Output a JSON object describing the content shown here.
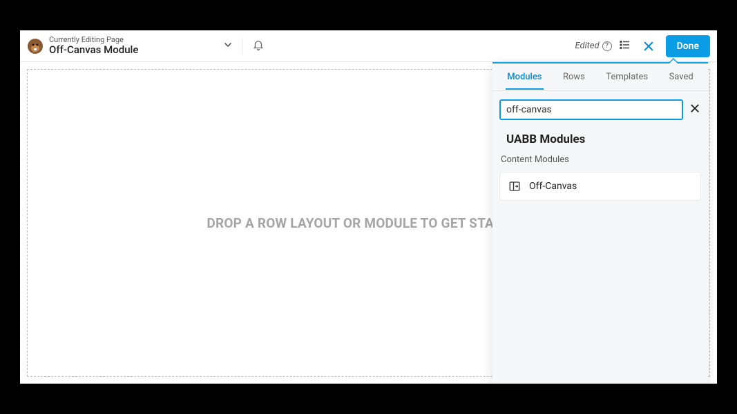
{
  "header": {
    "subtitle": "Currently Editing Page",
    "title": "Off-Canvas Module",
    "edited_label": "Edited",
    "done_label": "Done"
  },
  "canvas": {
    "placeholder": "DROP A ROW LAYOUT OR MODULE TO GET STARTED!"
  },
  "panel": {
    "tabs": [
      {
        "label": "Modules",
        "active": true
      },
      {
        "label": "Rows",
        "active": false
      },
      {
        "label": "Templates",
        "active": false
      },
      {
        "label": "Saved",
        "active": false
      }
    ],
    "search_value": "off-canvas",
    "group_heading": "UABB Modules",
    "sub_heading": "Content Modules",
    "modules": [
      {
        "label": "Off-Canvas"
      }
    ]
  },
  "colors": {
    "accent": "#0a9de5"
  }
}
